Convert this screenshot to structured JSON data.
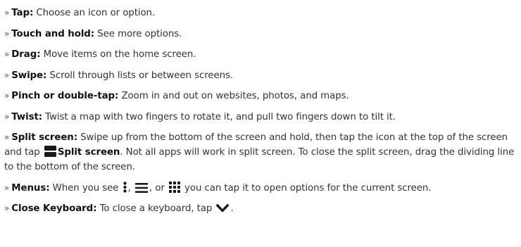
{
  "bullet": "»",
  "items": [
    {
      "term": "Tap:",
      "text": " Choose an icon or option."
    },
    {
      "term": "Touch and hold:",
      "text": " See more options."
    },
    {
      "term": "Drag:",
      "text": " Move items on the home screen."
    },
    {
      "term": "Swipe:",
      "text": " Scroll through lists or between screens."
    },
    {
      "term": "Pinch or double-tap:",
      "text": " Zoom in and out on websites, photos, and maps."
    },
    {
      "term": "Twist:",
      "text": " Twist a map with two fingers to rotate it, and pull two fingers down to tilt it."
    }
  ],
  "split": {
    "term": "Split screen:",
    "text_a": " Swipe up from the bottom of the screen and hold, then tap the icon at the top of the screen and tap ",
    "icon_label": "Split screen",
    "text_b": ". Not all apps will work in split screen. To close the split screen, drag the dividing line to the bottom of the screen."
  },
  "menus": {
    "term": "Menus:",
    "text_a": " When you see ",
    "sep_1": ", ",
    "sep_2": ", or ",
    "text_b": " you can tap it to open options for the current screen."
  },
  "keyboard": {
    "term": "Close Keyboard:",
    "text_a": " To close a keyboard, tap ",
    "text_b": "."
  },
  "icons": [
    "split-screen-icon",
    "more-vert-icon",
    "menu-lines-icon",
    "apps-grid-icon",
    "chevron-down-icon"
  ],
  "colors": {
    "text": "#333333",
    "term": "#111111"
  }
}
